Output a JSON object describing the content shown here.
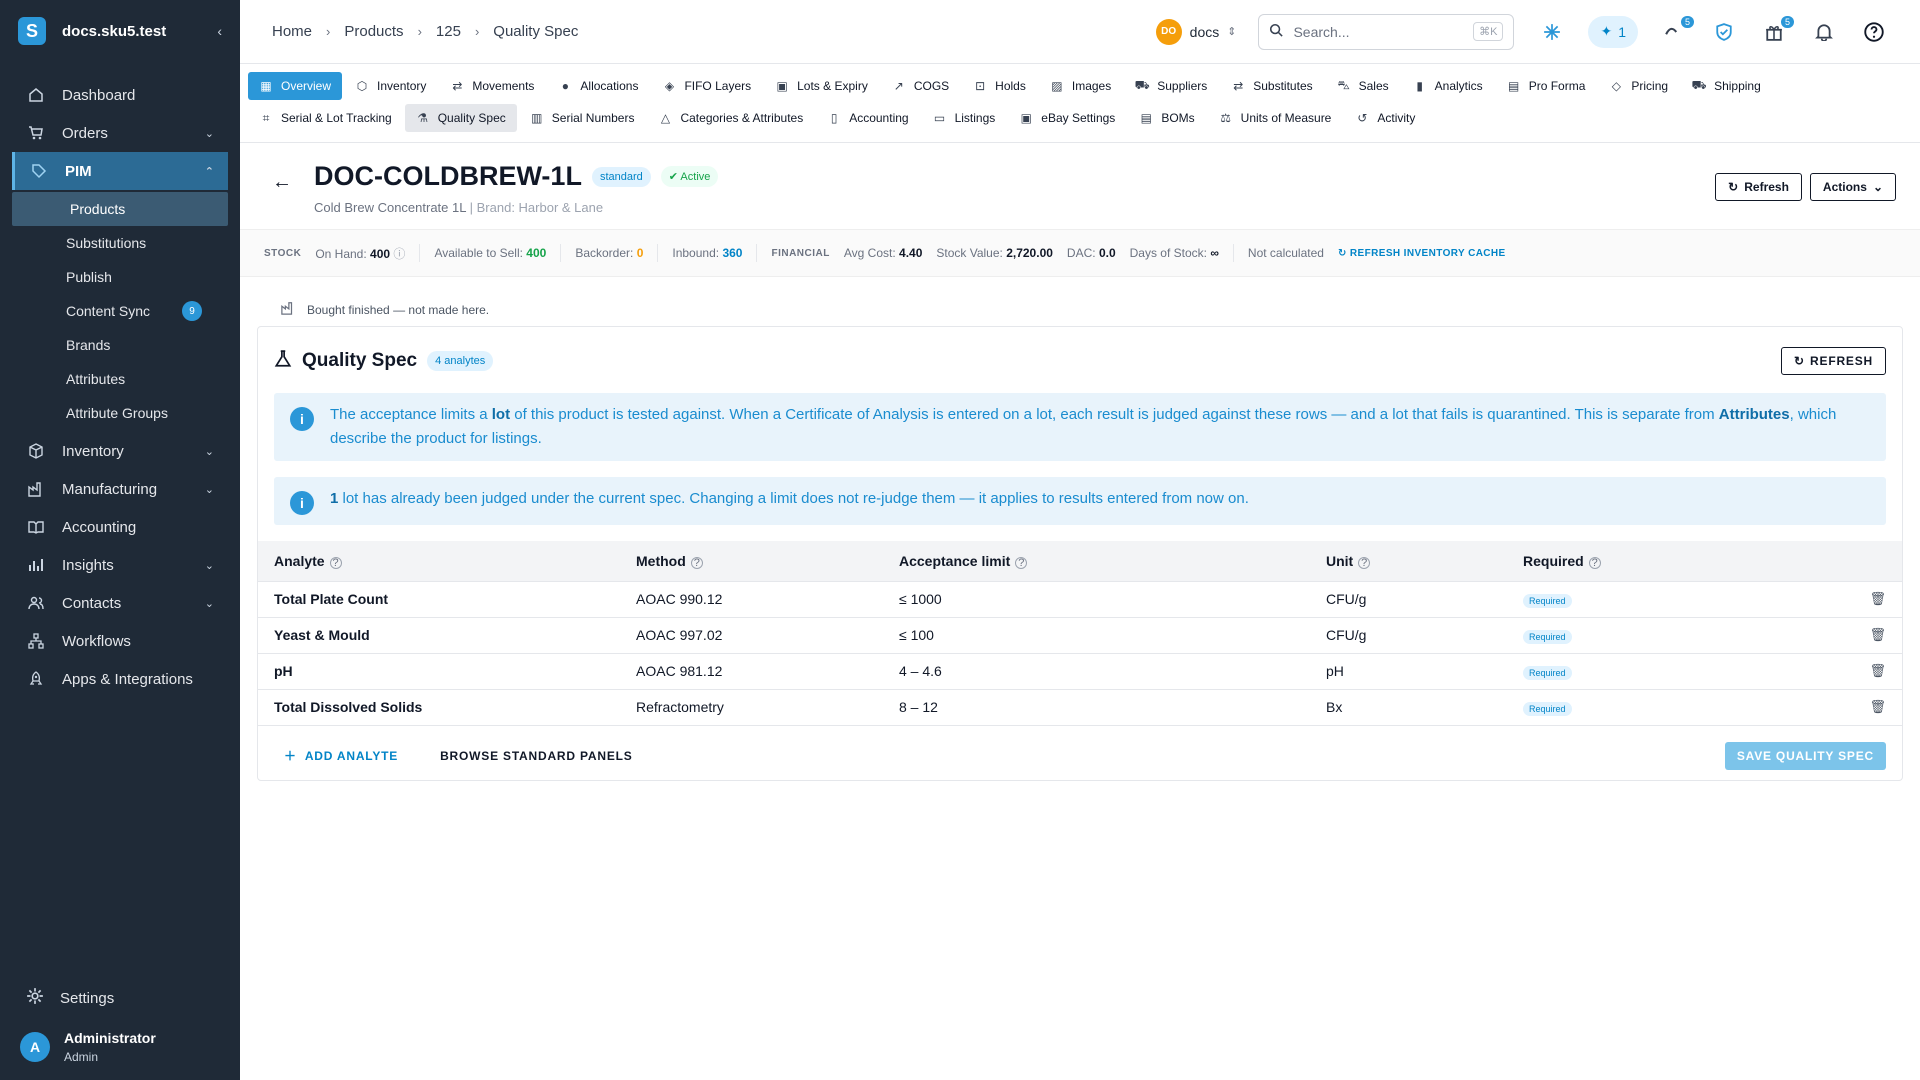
{
  "sidebar": {
    "title": "docs.sku5.test",
    "logo": "S",
    "nav": [
      {
        "label": "Dashboard",
        "icon": "home-icon"
      },
      {
        "label": "Orders",
        "icon": "cart-icon"
      },
      {
        "label": "PIM",
        "icon": "tag-icon"
      },
      {
        "label": "Inventory",
        "icon": "box-icon"
      },
      {
        "label": "Manufacturing",
        "icon": "factory-icon"
      },
      {
        "label": "Accounting",
        "icon": "book-icon"
      },
      {
        "label": "Insights",
        "icon": "chart-icon"
      },
      {
        "label": "Contacts",
        "icon": "people-icon"
      },
      {
        "label": "Workflows",
        "icon": "workflow-icon"
      },
      {
        "label": "Apps & Integrations",
        "icon": "rocket-icon"
      }
    ],
    "pim_sub": [
      "Products",
      "Substitutions",
      "Publish",
      "Content Sync",
      "Brands",
      "Attributes",
      "Attribute Groups"
    ],
    "content_sync_badge": "9",
    "settings": "Settings",
    "user": {
      "initial": "A",
      "name": "Administrator",
      "role": "Admin"
    }
  },
  "topbar": {
    "breadcrumbs": [
      "Home",
      "Products",
      "125",
      "Quality Spec"
    ],
    "workspace_initials": "DO",
    "workspace_name": "docs",
    "search_placeholder": "Search...",
    "search_shortcut": "⌘K",
    "ai_count": "1",
    "activity_badge": "5",
    "gift_badge": "5"
  },
  "tabs": {
    "row1": [
      "Overview",
      "Inventory",
      "Movements",
      "Allocations",
      "FIFO Layers",
      "Lots & Expiry",
      "COGS",
      "Holds",
      "Images",
      "Suppliers",
      "Substitutes",
      "Sales",
      "Analytics",
      "Pro Forma",
      "Pricing",
      "Shipping"
    ],
    "row2": [
      "Serial & Lot Tracking",
      "Quality Spec",
      "Serial Numbers",
      "Categories & Attributes",
      "Accounting",
      "Listings",
      "eBay Settings",
      "BOMs",
      "Units of Measure",
      "Activity"
    ]
  },
  "product": {
    "sku": "DOC-COLDBREW-1L",
    "type_chip": "standard",
    "status_chip": "Active",
    "name": "Cold Brew Concentrate 1L",
    "brand": "Brand: Harbor & Lane",
    "refresh_label": "Refresh",
    "actions_label": "Actions"
  },
  "stats": {
    "stock_heading": "STOCK",
    "on_hand_label": "On Hand:",
    "on_hand": "400",
    "available_label": "Available to Sell:",
    "available": "400",
    "backorder_label": "Backorder:",
    "backorder": "0",
    "inbound_label": "Inbound:",
    "inbound": "360",
    "financial_heading": "FINANCIAL",
    "avg_cost_label": "Avg Cost:",
    "avg_cost": "4.40",
    "stock_value_label": "Stock Value:",
    "stock_value": "2,720.00",
    "dac_label": "DAC:",
    "dac": "0.0",
    "days_label": "Days of Stock:",
    "days": "∞",
    "not_calculated": "Not calculated",
    "refresh_cache": "REFRESH INVENTORY CACHE"
  },
  "note": "Bought finished — not made here.",
  "spec": {
    "title": "Quality Spec",
    "count_chip": "4 analytes",
    "refresh_label": "REFRESH",
    "info1_a": "The acceptance limits a ",
    "info1_b": "lot",
    "info1_c": " of this product is tested against. When a Certificate of Analysis is entered on a lot, each result is judged against these rows — and a lot that fails is quarantined. This is separate from ",
    "info1_d": "Attributes",
    "info1_e": ", which describe the product for listings.",
    "info2_a": "1",
    "info2_b": " lot has already been judged under the current spec. Changing a limit does not re-judge them — it applies to results entered from now on.",
    "columns": [
      "Analyte",
      "Method",
      "Acceptance limit",
      "Unit",
      "Required"
    ],
    "rows": [
      {
        "analyte": "Total Plate Count",
        "method": "AOAC 990.12",
        "limit": "≤ 1000",
        "unit": "CFU/g",
        "required": "Required"
      },
      {
        "analyte": "Yeast & Mould",
        "method": "AOAC 997.02",
        "limit": "≤ 100",
        "unit": "CFU/g",
        "required": "Required"
      },
      {
        "analyte": "pH",
        "method": "AOAC 981.12",
        "limit": "4 – 4.6",
        "unit": "pH",
        "required": "Required"
      },
      {
        "analyte": "Total Dissolved Solids",
        "method": "Refractometry",
        "limit": "8 – 12",
        "unit": "Bx",
        "required": "Required"
      }
    ],
    "add_label": "ADD ANALYTE",
    "browse_label": "BROWSE STANDARD PANELS",
    "save_label": "SAVE QUALITY SPEC"
  },
  "colors": {
    "accent": "#2b97d8",
    "sidebar": "#1f2a37",
    "success": "#16a34a",
    "warning": "#f59e0b"
  }
}
